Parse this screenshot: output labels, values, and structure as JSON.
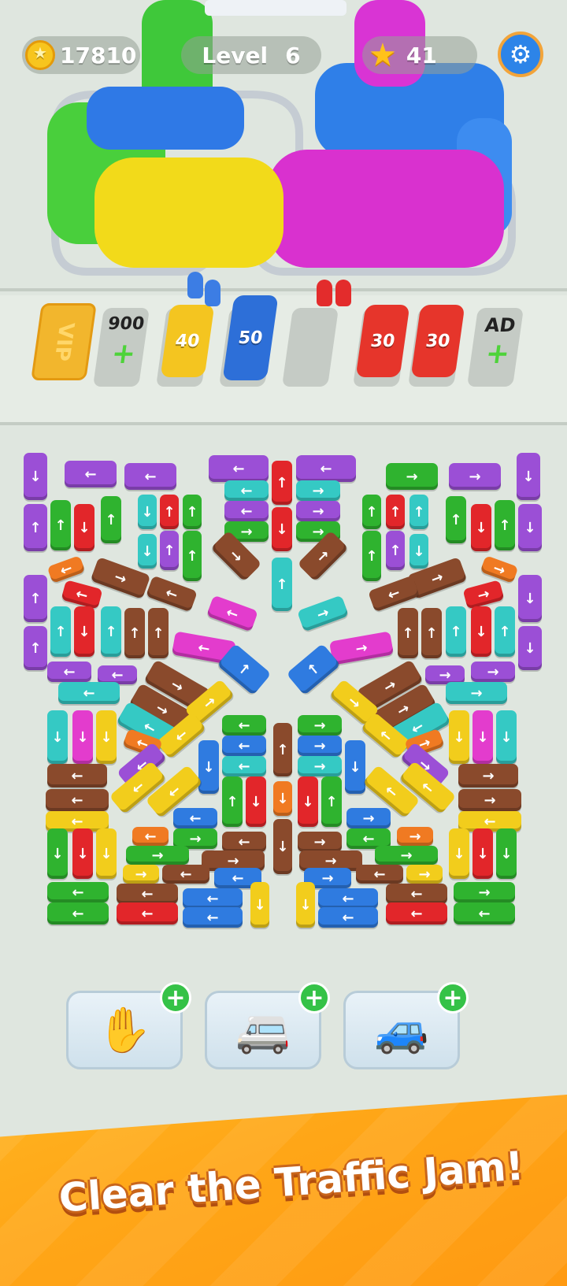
{
  "hud": {
    "coins": "17810",
    "level_label": "Level",
    "level_value": "6",
    "stars": "41",
    "settings_icon": "gear-icon"
  },
  "slots": {
    "vip_label": "VIP",
    "unlock_cost": "900",
    "ad_label": "AD",
    "cars": [
      {
        "capacity": "40",
        "color": "#f4c520"
      },
      {
        "capacity": "50",
        "color": "#2d6fd8"
      },
      {
        "capacity": "30",
        "color": "#e6352b"
      },
      {
        "capacity": "30",
        "color": "#e6352b"
      }
    ]
  },
  "boosters": [
    {
      "name": "claw",
      "icon": "claw-icon"
    },
    {
      "name": "van-swap",
      "icon": "van-icon"
    },
    {
      "name": "paint",
      "icon": "paint-car-icon"
    }
  ],
  "banner": {
    "tagline": "Clear the Traffic Jam!"
  },
  "palette": {
    "purple": "#9b4fd6",
    "green": "#2fb32f",
    "red": "#e2262a",
    "teal": "#35c9c4",
    "brown": "#8a4a2c",
    "magenta": "#e33ccd",
    "blue": "#2f7be0",
    "yellow": "#f2cd1c",
    "orange": "#f07a22"
  }
}
